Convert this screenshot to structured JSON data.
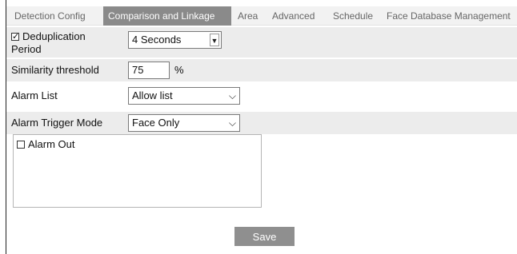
{
  "tabs": [
    {
      "label": "Detection Config",
      "active": false
    },
    {
      "label": "Comparison and Linkage",
      "active": true
    },
    {
      "label": "Area",
      "active": false
    },
    {
      "label": "Advanced",
      "active": false
    },
    {
      "label": "Schedule",
      "active": false
    },
    {
      "label": "Face Database Management",
      "active": false
    }
  ],
  "dedup": {
    "label_line1": "Deduplication",
    "label_line2": "Period",
    "checked": true,
    "value": "4 Seconds"
  },
  "similarity": {
    "label": "Similarity threshold",
    "value": "75",
    "unit": "%"
  },
  "alarm_list": {
    "label": "Alarm List",
    "value": "Allow list"
  },
  "trigger_mode": {
    "label": "Alarm Trigger Mode",
    "value": "Face Only"
  },
  "alarm_out": {
    "label": "Alarm Out",
    "checked": false
  },
  "save_label": "Save",
  "icons": {
    "dropdown_arrow": "chevron-down-icon",
    "checked_box": "checkbox-checked-icon",
    "unchecked_box": "checkbox-unchecked-icon"
  },
  "colors": {
    "active_tab_bg": "#8a8a8a",
    "row_shade": "#ececec",
    "button_bg": "#8f8f8f"
  }
}
